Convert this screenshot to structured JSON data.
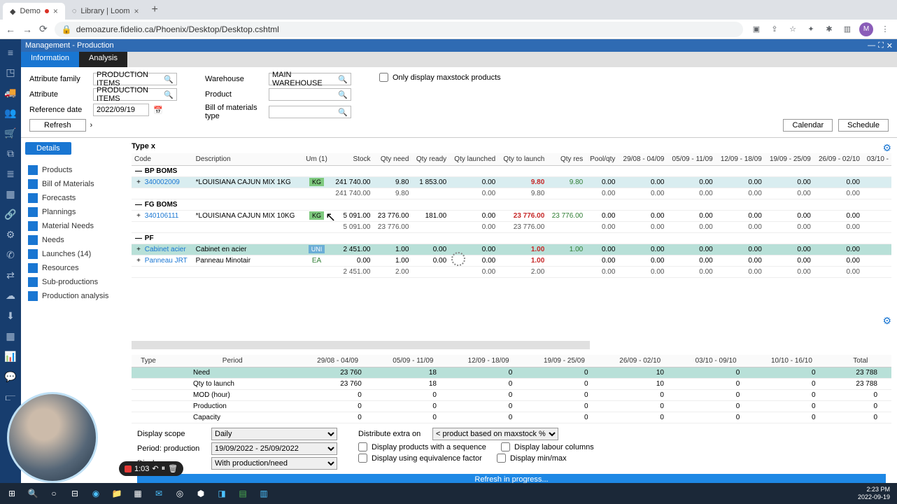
{
  "browser": {
    "tabs": [
      {
        "title": "Demo",
        "active": true,
        "dirty": true
      },
      {
        "title": "Library | Loom",
        "active": false
      }
    ],
    "url": "demoazure.fidelio.ca/Phoenix/Desktop/Desktop.cshtml",
    "avatar": "M"
  },
  "window": {
    "title": "Management - Production",
    "tabs": [
      "Information",
      "Analysis"
    ],
    "active_tab": "Information"
  },
  "filters": {
    "attr_family_label": "Attribute family",
    "attr_family_value": "PRODUCTION ITEMS",
    "attribute_label": "Attribute",
    "attribute_value": "PRODUCTION ITEMS",
    "refdate_label": "Reference date",
    "refdate_value": "2022/09/19",
    "warehouse_label": "Warehouse",
    "warehouse_value": "MAIN WAREHOUSE",
    "product_label": "Product",
    "product_value": "",
    "bom_label": "Bill of materials type",
    "bom_value": "",
    "maxstock_label": "Only display maxstock products",
    "refresh_btn": "Refresh",
    "calendar_btn": "Calendar",
    "schedule_btn": "Schedule"
  },
  "sidenav": {
    "details_tab": "Details",
    "items": [
      {
        "label": "Products"
      },
      {
        "label": "Bill of Materials"
      },
      {
        "label": "Forecasts"
      },
      {
        "label": "Plannings"
      },
      {
        "label": "Material Needs"
      },
      {
        "label": "Needs"
      },
      {
        "label": "Launches (14)"
      },
      {
        "label": "Resources"
      },
      {
        "label": "Sub-productions"
      },
      {
        "label": "Production analysis"
      }
    ]
  },
  "grid": {
    "type_lbl": "Type x",
    "columns": [
      "Code",
      "Description",
      "Um (1)",
      "Stock",
      "Qty need",
      "Qty ready",
      "Qty launched",
      "Qty to launch",
      "Qty res",
      "Pool/qty",
      "29/08 - 04/09",
      "05/09 - 11/09",
      "12/09 - 18/09",
      "19/09 - 25/09",
      "26/09 - 02/10",
      "03/10 -"
    ],
    "groups": [
      {
        "name": "BP BOMS",
        "rows": [
          {
            "code": "340002009",
            "desc": "*LOUISIANA CAJUN MIX 1KG",
            "um": "KG",
            "stock": "241 740.00",
            "need": "9.80",
            "ready": "1 853.00",
            "launched": "0.00",
            "tolaunch": "9.80",
            "res": "9.80",
            "pool": "0.00",
            "p1": "0.00",
            "p2": "0.00",
            "p3": "0.00",
            "p4": "0.00",
            "p5": "0.00",
            "p6": "",
            "hi": true
          }
        ],
        "sub": {
          "stock": "241 740.00",
          "need": "9.80",
          "ready": "",
          "launched": "0.00",
          "tolaunch": "9.80",
          "res": "",
          "pool": "0.00",
          "p1": "0.00",
          "p2": "0.00",
          "p3": "0.00",
          "p4": "0.00",
          "p5": "0.00"
        }
      },
      {
        "name": "FG BOMS",
        "rows": [
          {
            "code": "340106111",
            "desc": "*LOUISIANA CAJUN MIX 10KG",
            "um": "KG",
            "stock": "5 091.00",
            "need": "23 776.00",
            "ready": "181.00",
            "launched": "0.00",
            "tolaunch": "23 776.00",
            "res": "23 776.00",
            "pool": "0.00",
            "p1": "0.00",
            "p2": "0.00",
            "p3": "0.00",
            "p4": "0.00",
            "p5": "0.00",
            "p6": ""
          }
        ],
        "sub": {
          "stock": "5 091.00",
          "need": "23 776.00",
          "ready": "",
          "launched": "0.00",
          "tolaunch": "23 776.00",
          "res": "",
          "pool": "0.00",
          "p1": "0.00",
          "p2": "0.00",
          "p3": "0.00",
          "p4": "0.00",
          "p5": "0.00"
        }
      },
      {
        "name": "PF",
        "rows": [
          {
            "code": "Cabinet acier",
            "desc": "Cabinet en acier",
            "um": "UNI",
            "stock": "2 451.00",
            "need": "1.00",
            "ready": "0.00",
            "launched": "0.00",
            "tolaunch": "1.00",
            "res": "1.00",
            "pool": "0.00",
            "p1": "0.00",
            "p2": "0.00",
            "p3": "0.00",
            "p4": "0.00",
            "p5": "0.00",
            "p6": "",
            "sel": true
          },
          {
            "code": "Panneau JRT",
            "desc": "Panneau Minotair",
            "um": "EA",
            "stock": "0.00",
            "need": "1.00",
            "ready": "0.00",
            "launched": "0.00",
            "tolaunch": "1.00",
            "res": "",
            "pool": "0.00",
            "p1": "0.00",
            "p2": "0.00",
            "p3": "0.00",
            "p4": "0.00",
            "p5": "0.00",
            "p6": ""
          }
        ],
        "sub": {
          "stock": "2 451.00",
          "need": "2.00",
          "ready": "",
          "launched": "0.00",
          "tolaunch": "2.00",
          "res": "",
          "pool": "0.00",
          "p1": "0.00",
          "p2": "0.00",
          "p3": "0.00",
          "p4": "0.00",
          "p5": "0.00"
        }
      }
    ]
  },
  "lower": {
    "columns": [
      "Type",
      "Period",
      "29/08 - 04/09",
      "05/09 - 11/09",
      "12/09 - 18/09",
      "19/09 - 25/09",
      "26/09 - 02/10",
      "03/10 - 09/10",
      "10/10 - 16/10",
      "Total"
    ],
    "rows": [
      {
        "label": "Need",
        "vals": [
          "23 760",
          "18",
          "0",
          "0",
          "10",
          "0",
          "0",
          "23 788"
        ],
        "hi": true
      },
      {
        "label": "Qty to launch",
        "vals": [
          "23 760",
          "18",
          "0",
          "0",
          "10",
          "0",
          "0",
          "23 788"
        ]
      },
      {
        "label": "MOD (hour)",
        "vals": [
          "0",
          "0",
          "0",
          "0",
          "0",
          "0",
          "0",
          "0"
        ]
      },
      {
        "label": "Production",
        "vals": [
          "0",
          "0",
          "0",
          "0",
          "0",
          "0",
          "0",
          "0"
        ]
      },
      {
        "label": "Capacity",
        "vals": [
          "0",
          "0",
          "0",
          "0",
          "0",
          "0",
          "0",
          "0"
        ]
      }
    ]
  },
  "controls": {
    "scope_l": "Display scope",
    "scope_v": "Daily",
    "period_l": "Period: production",
    "period_v": "19/09/2022 - 25/09/2022",
    "display_l": "Display",
    "display_v": "With production/need",
    "dist_l": "Distribute extra on",
    "dist_v": "< product based on maxstock % >",
    "seq_l": "Display products with a sequence",
    "labour_l": "Display labour columns",
    "equiv_l": "Display using equivalence factor",
    "minmax_l": "Display min/max"
  },
  "progress": "Refresh in progress...",
  "loom": {
    "time": "1:03"
  },
  "clock": {
    "t": "2:23 PM",
    "d": "2022-09-19"
  }
}
